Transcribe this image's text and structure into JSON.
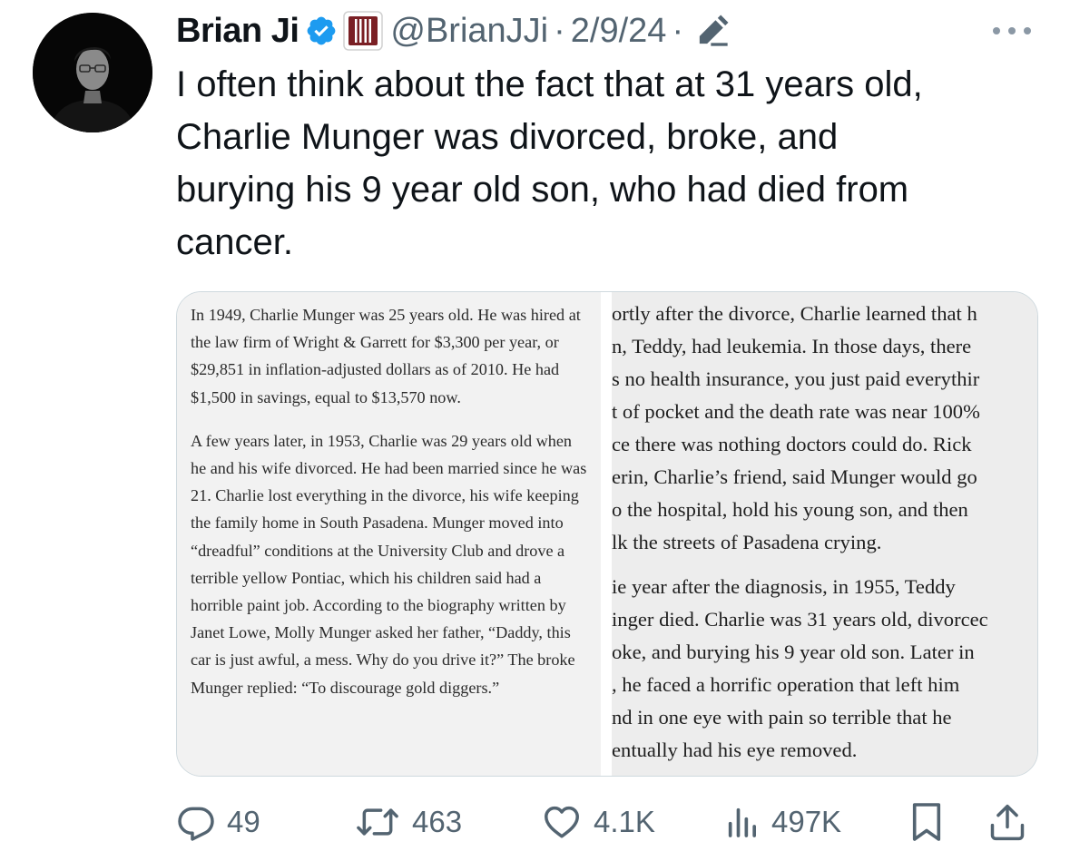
{
  "author": {
    "name": "Brian Ji",
    "handle": "@BrianJJi",
    "separator": "·",
    "date": "2/9/24",
    "date_separator": "·"
  },
  "icons": {
    "avatar": "profile-photo",
    "verified": "verified-badge-icon",
    "affiliate": "affiliate-badge-icon",
    "edit": "edited-pencil-icon",
    "more": "more-icon",
    "reply": "reply-icon",
    "retweet": "retweet-icon",
    "like": "like-icon",
    "views": "views-icon",
    "bookmark": "bookmark-icon",
    "share": "share-icon"
  },
  "colors": {
    "verified_blue": "#1d9bf0",
    "affiliate_red": "#7a1f24",
    "muted": "#536471"
  },
  "tweet": {
    "text": "I often think about the fact that at 31 years old,\nCharlie Munger was divorced, broke, and\nburying his 9 year old son, who had died from\ncancer."
  },
  "media": {
    "left": {
      "paragraph1": "In 1949, Charlie Munger was 25 years old. He was hired at the law firm of Wright & Garrett for $3,300 per year, or $29,851 in inflation-adjusted dollars as of 2010. He had $1,500 in savings, equal to $13,570 now.",
      "paragraph2": "A few years later, in 1953, Charlie was 29 years old when he and his wife divorced.  He had been married since he was 21.  Charlie lost everything in the divorce, his wife keeping the family home in South Pasadena.  Munger moved into “dreadful” conditions at the University Club and drove a terrible yellow Pontiac, which his children said had a horrible paint job.  According to the biography written by Janet Lowe, Molly Munger asked her father, “Daddy, this car is just awful, a mess.  Why do you drive it?”  The broke Munger replied: “To discourage gold diggers.”"
    },
    "right": {
      "paragraph1": [
        "ortly after the divorce, Charlie learned that h",
        "n, Teddy, had leukemia.  In those days, there",
        "s no health insurance, you just paid everythir",
        "t of pocket and the death rate was near 100%",
        "ce there was nothing doctors could do.  Rick",
        "erin, Charlie’s friend, said Munger would go",
        "o the hospital, hold his young son, and then",
        "lk the streets of Pasadena crying."
      ],
      "paragraph2": [
        "ie year after the diagnosis, in 1955, Teddy",
        "inger died.  Charlie was 31 years old, divorcec",
        "oke, and burying his 9 year old son.  Later in",
        ", he faced a horrific operation that left him",
        "nd in one eye with pain so terrible that he",
        "entually had his eye removed."
      ]
    }
  },
  "actions": {
    "replies": "49",
    "retweets": "463",
    "likes": "4.1K",
    "views": "497K"
  }
}
